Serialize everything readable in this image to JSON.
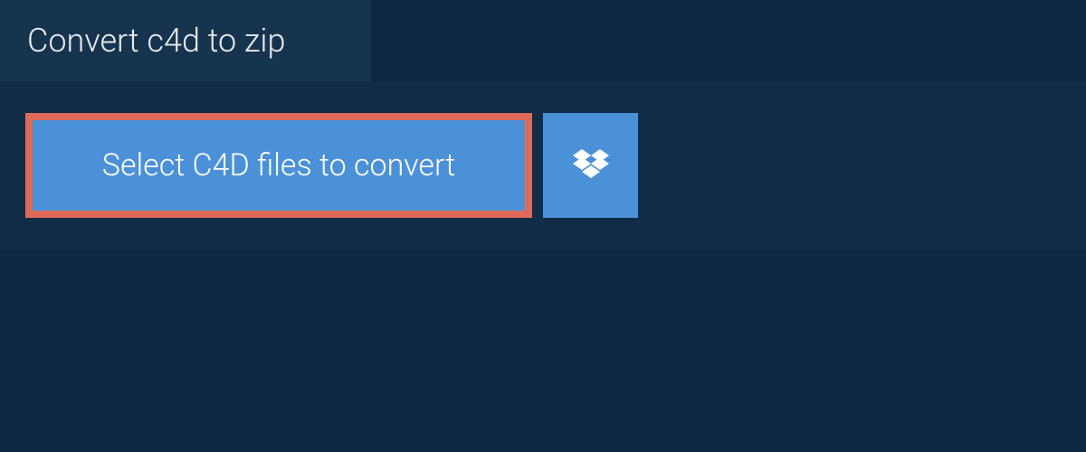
{
  "tab": {
    "title": "Convert c4d to zip"
  },
  "actions": {
    "select_files_label": "Select C4D files to convert",
    "dropbox_icon_name": "dropbox"
  },
  "colors": {
    "background": "#0d2841",
    "panel": "#102c46",
    "tab": "#17344f",
    "button": "#4b91d8",
    "highlight_border": "#e06a5a"
  }
}
